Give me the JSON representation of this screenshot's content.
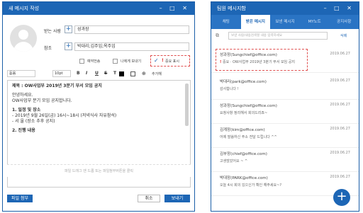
{
  "compose": {
    "title": "새 메시지 작성",
    "window_controls": "–  □  ✕",
    "recipient_label": "받는 사람",
    "recipient_value": "성과장",
    "cc_label": "참조",
    "cc_value": "박대리;김주임;옥주임",
    "options": {
      "reserve_send": "예약전송",
      "send_to_me": "나에게 보내기",
      "important": "중요 표시"
    },
    "toolbar": {
      "font": "돋움",
      "size": "10pt",
      "bold": "B",
      "italic": "I",
      "underline": "U",
      "strike": "S",
      "color": "T",
      "extra": "추가해"
    },
    "body": {
      "title": "제목 : OW사업부 2019년 3분기 부서 모임 공지",
      "lines": [
        "안녕하세요.",
        "OW사업부 분기 모임 공지합니다.",
        "1. 일정 및 장소",
        "- 2019년 9월 26일(금) 16시~18시 (저녁식사 자유참석)",
        "- 서 울 (장소 추후 공지)",
        "2. 진행 내용"
      ]
    },
    "attach_hint": "파일 드래그 앤 드롭 또는 파일첨부버튼을 클릭",
    "attach_button": "파일 첨부",
    "cancel_button": "취소",
    "send_button": "보내기"
  },
  "messenger": {
    "title": "팀원 메시지함",
    "window_controls": "–  □  ✕",
    "tabs": [
      "채팅",
      "받은 메시지",
      "보낸 메시지",
      "MY노트",
      "공지사항"
    ],
    "search_placeholder": "보낸 사람/내용검색할 내용 입력하세요",
    "search_button": "삭제",
    "items": [
      {
        "from": "성과장(Sungchief@office.com)",
        "date": "2019.06.27",
        "text": "중요 · OW사업부 2019년 3분기 부서 모임 공지",
        "important": true
      },
      {
        "from": "박대리(park@office.com)",
        "date": "2019.06.27",
        "text": "감사합니다 !",
        "important": false
      },
      {
        "from": "성과장(Sungchief@office.com)",
        "date": "2019.06.27",
        "text": "요청사항 정리해서 회의드리죠~",
        "important": false
      },
      {
        "from": "김계장(kim@office.com)",
        "date": "2019.06.27",
        "text": "어제 말씀하신 주소 전달 드립니다 ^^",
        "important": false
      },
      {
        "from": "김부장(chief@office.com)",
        "date": "2019.06.27",
        "text": "고생많았어요 ~ ^",
        "important": false
      },
      {
        "from": "박대장(PARK@office.com)",
        "date": "2019.06.27",
        "text": "오늘 4시 회의 있으신가 확인 해주세요~?",
        "important": false
      }
    ],
    "fab_label": "+"
  }
}
